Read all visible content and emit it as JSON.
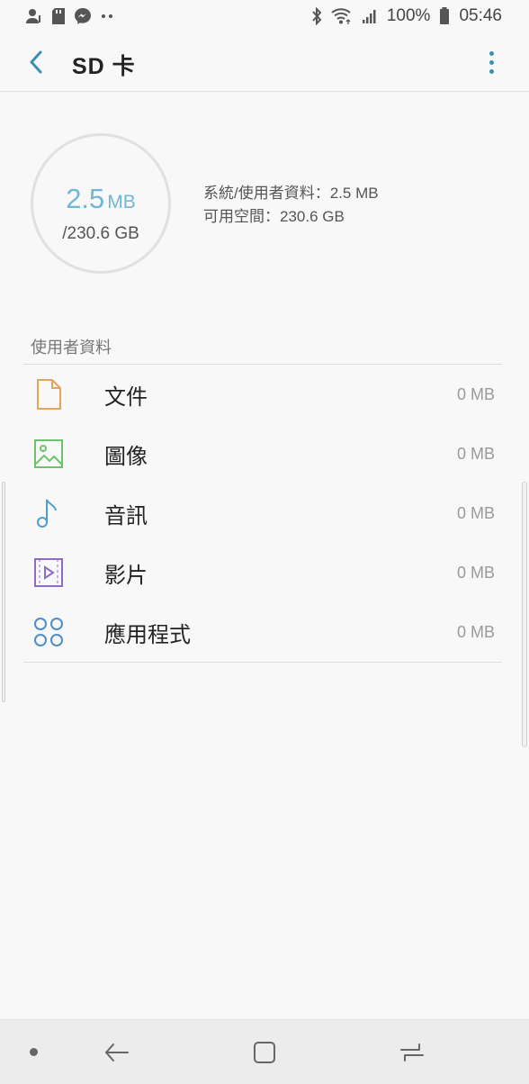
{
  "status_bar": {
    "time": "05:46",
    "battery": "100%",
    "icons_left": [
      "contact-icon",
      "sd-card-icon",
      "messenger-icon",
      "more-notifications-icon"
    ],
    "icons_right": [
      "bluetooth-icon",
      "wifi-icon",
      "signal-icon",
      "battery-icon"
    ]
  },
  "app_bar": {
    "title": "SD 卡",
    "back_icon": "back-icon",
    "more_icon": "more-options-icon"
  },
  "storage": {
    "used_value": "2.5",
    "used_unit": "MB",
    "total": "/230.6 GB",
    "system_user_data": "系統/使用者資料：2.5 MB",
    "available": "可用空間：230.6 GB",
    "used_fraction": 1e-05
  },
  "section": {
    "title": "使用者資料",
    "items": [
      {
        "label": "文件",
        "size": "0 MB",
        "icon": "document-icon",
        "color": "#e3a45c"
      },
      {
        "label": "圖像",
        "size": "0 MB",
        "icon": "image-icon",
        "color": "#6cc46a"
      },
      {
        "label": "音訊",
        "size": "0 MB",
        "icon": "music-note-icon",
        "color": "#4f9fc9"
      },
      {
        "label": "影片",
        "size": "0 MB",
        "icon": "video-icon",
        "color": "#8b6cc1"
      },
      {
        "label": "應用程式",
        "size": "0 MB",
        "icon": "apps-icon",
        "color": "#4f8dc9"
      }
    ]
  },
  "nav_bar": {
    "items": [
      "nav-dot-icon",
      "nav-back-icon",
      "home-icon",
      "recents-icon"
    ]
  },
  "colors": {
    "accent": "#3d8fb0",
    "used_text": "#6fb7d4"
  }
}
